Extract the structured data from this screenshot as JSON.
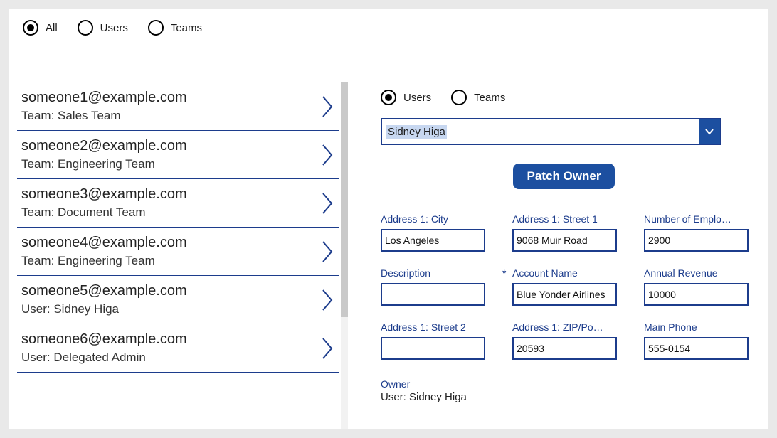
{
  "topFilter": {
    "options": [
      {
        "id": "all",
        "label": "All",
        "selected": true
      },
      {
        "id": "users",
        "label": "Users",
        "selected": false
      },
      {
        "id": "teams",
        "label": "Teams",
        "selected": false
      }
    ]
  },
  "list": [
    {
      "email": "someone1@example.com",
      "sub": "Team: Sales Team"
    },
    {
      "email": "someone2@example.com",
      "sub": "Team: Engineering Team"
    },
    {
      "email": "someone3@example.com",
      "sub": "Team: Document Team"
    },
    {
      "email": "someone4@example.com",
      "sub": "Team: Engineering Team"
    },
    {
      "email": "someone5@example.com",
      "sub": "User: Sidney Higa"
    },
    {
      "email": "someone6@example.com",
      "sub": "User: Delegated Admin"
    }
  ],
  "detailFilter": {
    "options": [
      {
        "id": "users",
        "label": "Users",
        "selected": true
      },
      {
        "id": "teams",
        "label": "Teams",
        "selected": false
      }
    ]
  },
  "combo": {
    "value": "Sidney Higa"
  },
  "patchButton": "Patch Owner",
  "fields": {
    "city": {
      "label": "Address 1: City",
      "value": "Los Angeles"
    },
    "street1": {
      "label": "Address 1: Street 1",
      "value": "9068 Muir Road"
    },
    "employees": {
      "label": "Number of Emplo…",
      "value": "2900"
    },
    "description": {
      "label": "Description",
      "value": ""
    },
    "account": {
      "label": "Account Name",
      "value": "Blue Yonder Airlines",
      "required": true
    },
    "revenue": {
      "label": "Annual Revenue",
      "value": "10000"
    },
    "street2": {
      "label": "Address 1: Street 2",
      "value": ""
    },
    "zip": {
      "label": "Address 1: ZIP/Po…",
      "value": "20593"
    },
    "phone": {
      "label": "Main Phone",
      "value": "555-0154"
    }
  },
  "owner": {
    "label": "Owner",
    "value": "User: Sidney Higa"
  }
}
